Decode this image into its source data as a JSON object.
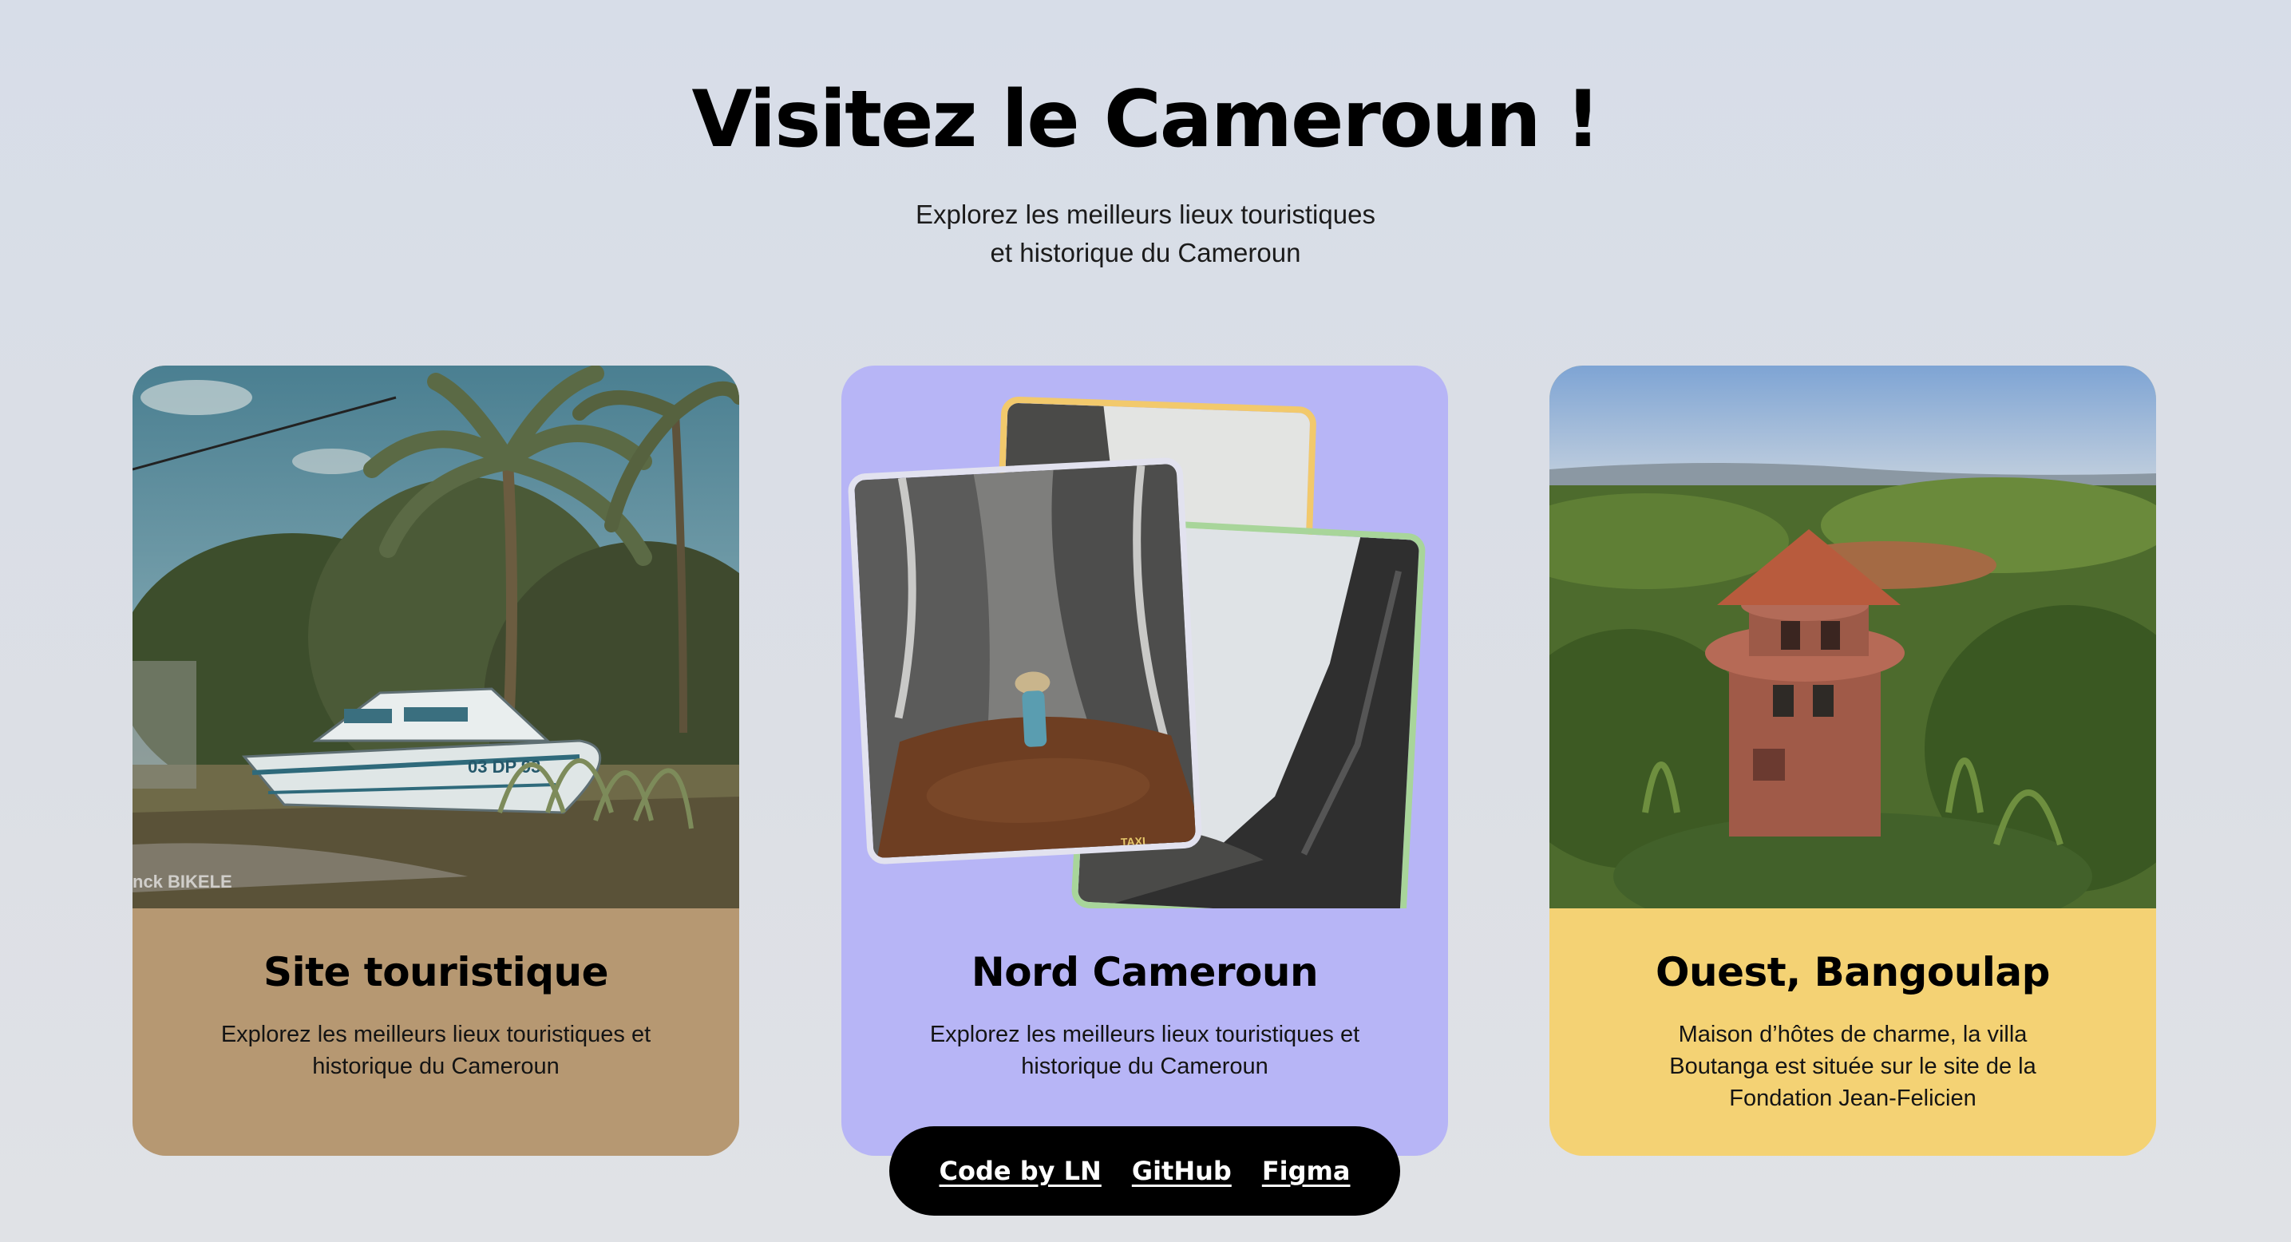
{
  "header": {
    "title": "Visitez le Cameroun !",
    "subtitle_line1": "Explorez les meilleurs lieux touristiques",
    "subtitle_line2": "et historique du Cameroun"
  },
  "cards": [
    {
      "title": "Site touristique",
      "description": "Explorez les meilleurs lieux touristiques et historique du Cameroun",
      "image_watermark": "nck BIKELE",
      "boat_registration": "03 DP 93",
      "color": "#b69872"
    },
    {
      "title": "Nord Cameroun",
      "description": "Explorez les meilleurs lieux touristiques et historique du Cameroun",
      "photo_caption": "TAXI",
      "color": "#b7b5f6"
    },
    {
      "title": "Ouest, Bangoulap",
      "description": "Maison d’hôtes de charme, la villa Boutanga est située sur le site de la Fondation Jean-Felicien",
      "color": "#f4d274"
    }
  ],
  "footer": {
    "links": [
      "Code by LN",
      "GitHub",
      "Figma"
    ]
  }
}
